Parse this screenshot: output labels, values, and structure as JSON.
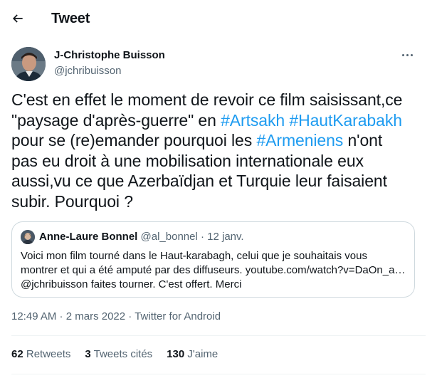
{
  "header": {
    "title": "Tweet",
    "back_icon": "arrow-left-icon"
  },
  "author": {
    "name": "J-Christophe Buisson",
    "handle": "@jchribuisson",
    "avatar_icon": "profile-photo"
  },
  "more_icon": "more-horizontal-icon",
  "tweet": {
    "line1": "C'est en effet le moment de revoir ce film saisissant,ce",
    "line2_pre": "\"paysage d'après-guerre\" en ",
    "hashtag1": "#Artsakh",
    "line2_mid": " ",
    "hashtag2": "#HautKarabakh",
    "line3_pre": "pour se (re)emander pourquoi les ",
    "hashtag3": "#Armeniens",
    "line3_post": " n'ont",
    "line4": "pas eu droit à une mobilisation internationale eux",
    "line5": "aussi,vu ce que Azerbaïdjan et Turquie leur faisaient",
    "line6": "subir. Pourquoi ?"
  },
  "quote": {
    "name": "Anne-Laure Bonnel",
    "handle": "@al_bonnel",
    "separator": "·",
    "date": "12 janv.",
    "line1": "Voici mon film tourné dans le Haut-karabagh, celui que je souhaitais vous",
    "line2": "montrer et qui a été amputé par des diffuseurs. youtube.com/watch?v=DaOn_a…",
    "line3": "@jchribuisson faites tourner. C'est offert. Merci"
  },
  "meta": {
    "time": "12:49 AM",
    "sep1": " · ",
    "date": "2 mars 2022",
    "sep2": " · ",
    "source": "Twitter for Android"
  },
  "stats": {
    "retweets_count": "62",
    "retweets_label": "Retweets",
    "quotes_count": "3",
    "quotes_label": "Tweets cités",
    "likes_count": "130",
    "likes_label": "J'aime"
  },
  "colors": {
    "accent": "#1d9bf0",
    "text": "#0f1419",
    "secondary": "#536471",
    "border": "#cfd9de"
  }
}
